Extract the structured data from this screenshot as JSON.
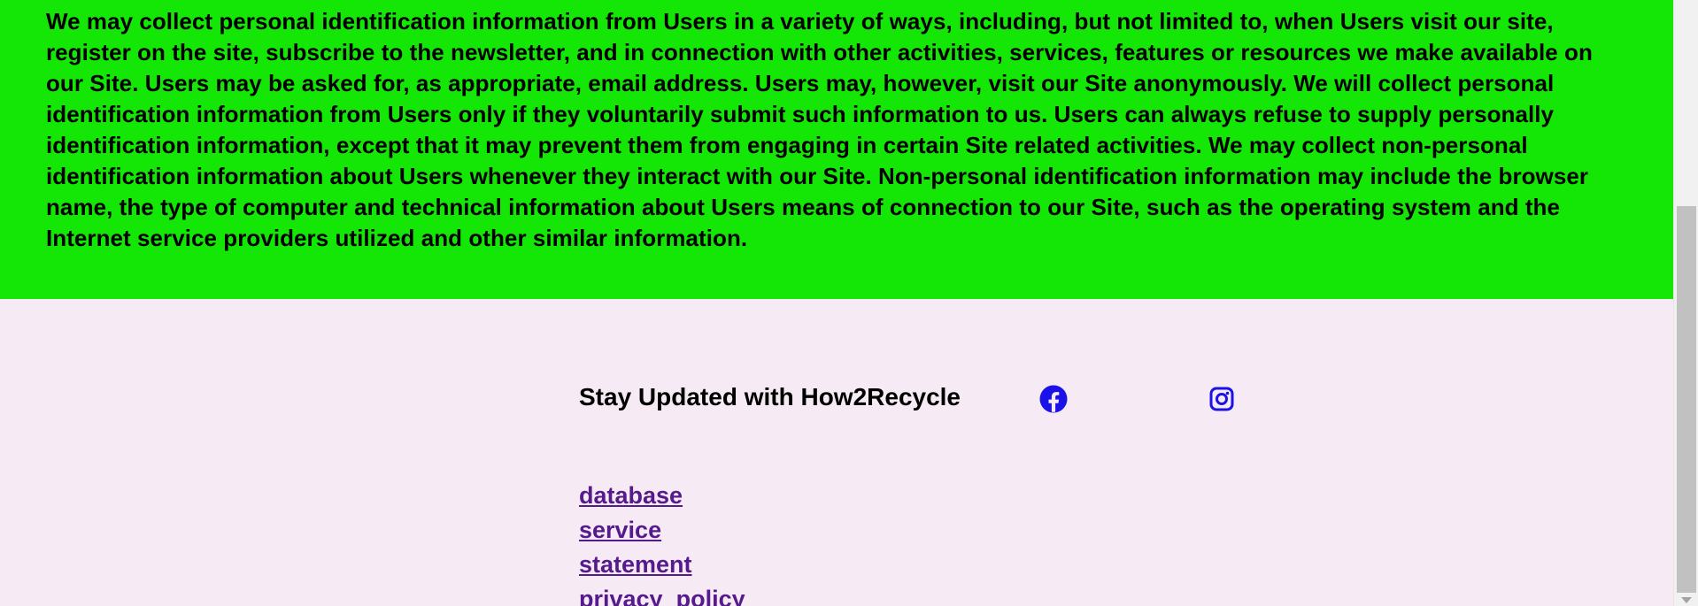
{
  "privacy": {
    "paragraph": "We may collect personal identification information from Users in a variety of ways, including, but not limited to, when Users visit our site, register on the site, subscribe to the newsletter, and in connection with other activities, services, features or resources we make available on our Site. Users may be asked for, as appropriate, email address. Users may, however, visit our Site anonymously. We will collect personal identification information from Users only if they voluntarily submit such information to us. Users can always refuse to supply personally identification information, except that it may prevent them from engaging in certain Site related activities. We may collect non-personal identification information about Users whenever they interact with our Site. Non-personal identification information may include the browser name, the type of computer and technical information about Users means of connection to our Site, such as the operating system and the Internet service providers utilized and other similar information."
  },
  "footer": {
    "title": "Stay Updated with How2Recycle",
    "social": [
      {
        "icon": "facebook-icon"
      },
      {
        "icon": "instagram-icon"
      }
    ],
    "links": [
      {
        "label": "database"
      },
      {
        "label": "service"
      },
      {
        "label": "statement"
      },
      {
        "label": "privacy_policy"
      }
    ]
  },
  "colors": {
    "green": "#14e606",
    "footer_bg": "#f6eaf4",
    "link": "#551a8b",
    "social_icon": "#1a12e6"
  }
}
